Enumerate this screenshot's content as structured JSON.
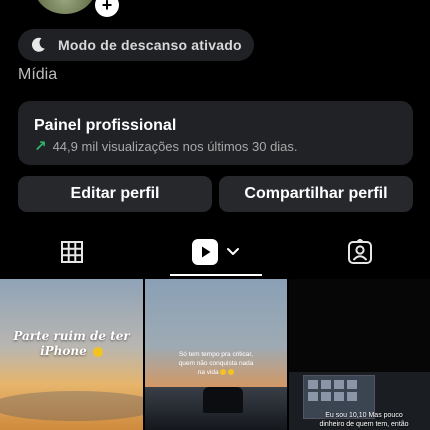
{
  "profile": {
    "rest_mode_label": "Modo de descanso ativado",
    "media_label": "Mídia"
  },
  "pro_panel": {
    "title": "Painel profissional",
    "stats": "44,9 mil visualizações nos últimos 30 dias."
  },
  "actions": {
    "edit_label": "Editar perfil",
    "share_label": "Compartilhar perfil"
  },
  "tabs": {
    "active": "reels"
  },
  "posts": [
    {
      "caption_l1": "Parte ruim de ter",
      "caption_l2": "iPhone"
    },
    {
      "caption_l1": "Só tem tempo pra criticar,",
      "caption_l2": "quem não conquista nada",
      "caption_l3": "na vida"
    },
    {
      "caption_l1": "Eu sou 10,10 Mas pouco",
      "caption_l2": "dinheiro de quem tem, então"
    }
  ],
  "colors": {
    "background": "#000000",
    "card": "#202226",
    "button": "#26282c",
    "growth_arrow": "#2fb36a"
  }
}
